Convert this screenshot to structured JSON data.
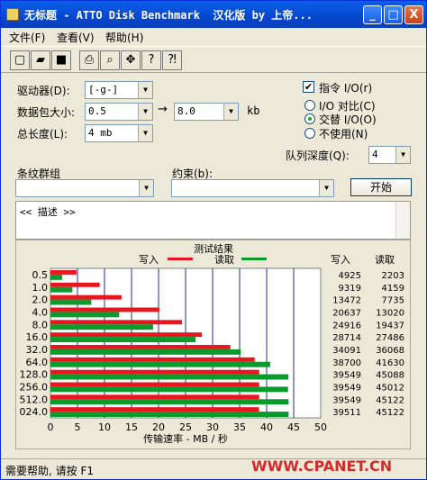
{
  "window": {
    "title": "无标题 - ATTO Disk Benchmark  汉化版 by 上帝...",
    "min_label": "_",
    "max_label": "□",
    "close_label": "X"
  },
  "menu": {
    "file": "文件(F)",
    "view": "查看(V)",
    "help": "帮助(H)"
  },
  "toolbar": {
    "icons": [
      "new-file-icon",
      "open-folder-icon",
      "save-icon",
      "print-icon",
      "print-preview-icon",
      "move-icon",
      "help-icon",
      "context-help-icon"
    ],
    "glyphs": [
      "▢",
      "▰",
      "■",
      "⎙",
      "⌕",
      "✥",
      "?",
      "⁈"
    ]
  },
  "settings": {
    "drive_label": "驱动器(D):",
    "drive_value": "[-g-]",
    "packet_label": "数据包大小:",
    "packet_from": "0.5",
    "arrow": "→",
    "packet_to": "8.0",
    "packet_unit": "kb",
    "length_label": "总长度(L):",
    "length_value": "4 mb",
    "direct_io_label": "指令 I/O(r)",
    "direct_io_checked": "✔",
    "io_compare_label": "I/O 对比(C)",
    "overlapped_label": "交替 I/O(O)",
    "disabled_label": "不使用(N)",
    "queue_label": "队列深度(Q):",
    "queue_value": "4",
    "stripe_label": "条纹群组",
    "constraint_label": "约束(b):",
    "start_button": "开始",
    "description": "<< 描述 >>"
  },
  "results": {
    "header": "测试结果",
    "legend_write": "写入",
    "legend_read": "读取",
    "col_write": "写入",
    "col_read": "读取",
    "write_color": "#e8161e",
    "read_color": "#0b9a2c"
  },
  "chart_data": {
    "type": "bar",
    "categories": [
      "0.5",
      "1.0",
      "2.0",
      "4.0",
      "8.0",
      "16.0",
      "32.0",
      "64.0",
      "128.0",
      "256.0",
      "512.0",
      "024.0"
    ],
    "series": [
      {
        "name": "写入",
        "values": [
          4925,
          9319,
          13472,
          20637,
          24916,
          28714,
          34091,
          38700,
          39549,
          39549,
          39549,
          39511
        ]
      },
      {
        "name": "读取",
        "values": [
          2203,
          4159,
          7735,
          13020,
          19437,
          27486,
          36068,
          41630,
          45088,
          45012,
          45122,
          45122
        ]
      }
    ],
    "x_ticks": [
      "0",
      "5",
      "10",
      "15",
      "20",
      "25",
      "30",
      "35",
      "40",
      "45",
      "50"
    ],
    "xlim": [
      0,
      50
    ],
    "xlabel": "传输速率 - MB / 秒",
    "ylabel": "",
    "title": "测试结果",
    "grid": true
  },
  "status": {
    "text": "需要帮助, 请按 F1",
    "watermark": "WWW.CPANET.CN"
  }
}
